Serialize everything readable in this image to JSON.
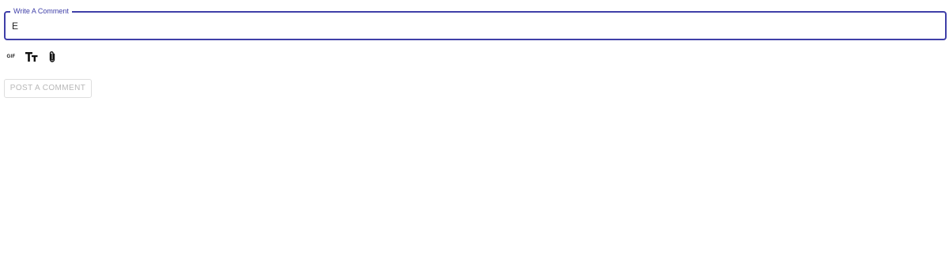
{
  "comment_form": {
    "label": "Write A Comment",
    "value": "E",
    "accent_color": "#3f3fa8"
  },
  "toolbar": {
    "gif_label": "GIF",
    "tools": [
      {
        "name": "gif",
        "icon": "gif-icon"
      },
      {
        "name": "text-format",
        "icon": "text-format-icon"
      },
      {
        "name": "attachment",
        "icon": "paperclip-icon"
      }
    ]
  },
  "post_button": {
    "label": "POST A COMMENT",
    "state": "disabled"
  }
}
